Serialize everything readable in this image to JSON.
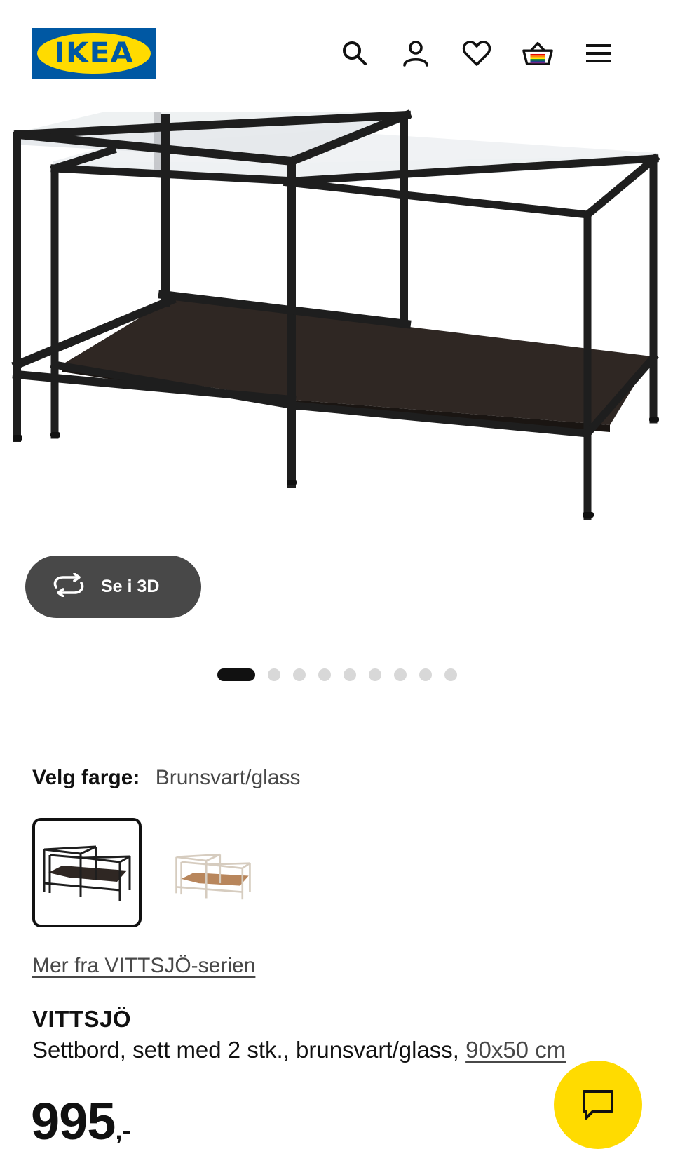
{
  "header": {
    "logo_text": "IKEA",
    "logo_reg": "®",
    "icons": [
      "search-icon",
      "account-icon",
      "favorites-heart-icon",
      "cart-basket-icon",
      "menu-hamburger-icon"
    ]
  },
  "gallery": {
    "view_3d_label": "Se i 3D",
    "total_images": 9,
    "active_index": 0
  },
  "color": {
    "label": "Velg farge:",
    "selected_value": "Brunsvart/glass",
    "options": [
      "Brunsvart/glass",
      "Hvit/glass"
    ]
  },
  "series_link": "Mer fra VITTSJÖ-serien",
  "product": {
    "name": "VITTSJÖ",
    "description": "Settbord, sett med 2 stk., brunsvart/glass,",
    "dimensions": "90x50 cm",
    "price_integer": "995",
    "price_suffix": ",-"
  },
  "colors": {
    "brand_blue": "#0058a3",
    "brand_yellow": "#ffdb00",
    "button_dark": "#484848",
    "frame": "#1e1e1e",
    "shelf": "#2f2723"
  }
}
